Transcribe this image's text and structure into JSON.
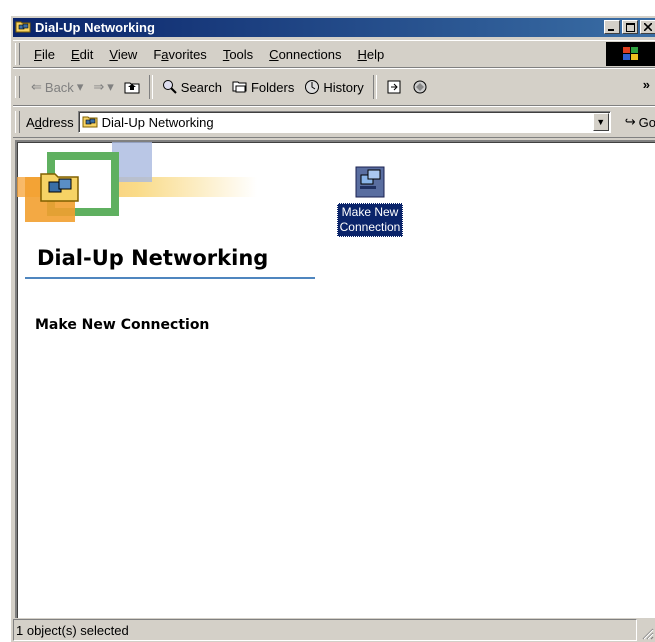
{
  "window": {
    "title": "Dial-Up Networking"
  },
  "menubar": {
    "items": [
      {
        "label": "File",
        "accel": "F",
        "rest": "ile"
      },
      {
        "label": "Edit",
        "accel": "E",
        "rest": "dit"
      },
      {
        "label": "View",
        "accel": "V",
        "rest": "iew"
      },
      {
        "label": "Favorites",
        "pre": "F",
        "accel": "a",
        "rest": "vorites"
      },
      {
        "label": "Tools",
        "accel": "T",
        "rest": "ools"
      },
      {
        "label": "Connections",
        "accel": "C",
        "rest": "onnections"
      },
      {
        "label": "Help",
        "accel": "H",
        "rest": "elp"
      }
    ]
  },
  "toolbar": {
    "back": "Back",
    "search": "Search",
    "folders": "Folders",
    "history": "History",
    "more": "»"
  },
  "address": {
    "label_pre": "A",
    "label_accel": "d",
    "label_rest": "dress",
    "value": "Dial-Up Networking",
    "go": "Go"
  },
  "content": {
    "heading": "Dial-Up Networking",
    "selected_item_name": "Make New Connection",
    "icon_label_line1": "Make New",
    "icon_label_line2": "Connection"
  },
  "status": {
    "text": "1 object(s) selected"
  },
  "colors": {
    "title_start": "#0a246a",
    "title_end": "#3a6ea5",
    "chrome": "#d4d0c8",
    "selection": "#0a246a"
  }
}
